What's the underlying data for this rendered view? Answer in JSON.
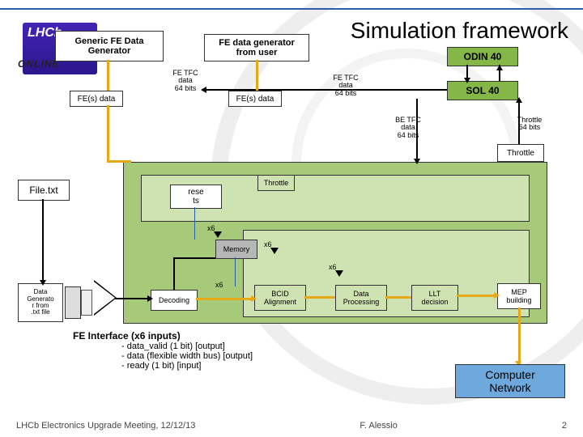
{
  "title": "Simulation framework",
  "logo": {
    "top": "LHCb",
    "bottom": "ONLINE"
  },
  "top_boxes": {
    "generic_generator_l1": "Generic FE Data",
    "generic_generator_l2": "Generator",
    "user_generator_l1": "FE data generator",
    "user_generator_l2": "from user",
    "odin": "ODIN 40",
    "sol": "SOL 40",
    "throttle": "Throttle"
  },
  "fe_data_boxes": {
    "left": "FE(s) data",
    "right": "FE(s) data"
  },
  "tfc_labels": {
    "fe_tfc_1": "FE TFC\ndata\n64 bits",
    "fe_tfc_2": "FE TFC\ndata\n64 bits",
    "be_tfc": "BE TFC\ndata\n64 bits",
    "throttle64": "Throttle\n64 bits"
  },
  "dsp": {
    "resets_l1": "rese",
    "resets_l2": "ts",
    "throttle": "Throttle",
    "memory": "Memory",
    "decoding": "Decoding",
    "bcid_l1": "BCID",
    "bcid_l2": "Alignment",
    "dproc_l1": "Data",
    "dproc_l2": "Processing",
    "llt_l1": "LLT",
    "llt_l2": "decision",
    "mep_l1": "MEP",
    "mep_l2": "building",
    "x6": "x6"
  },
  "left_blocks": {
    "file": "File.txt",
    "datagen_l1": "Data",
    "datagen_l2": "Generato",
    "datagen_l3": "r from",
    "datagen_l4": ".txt file"
  },
  "fe_interface": {
    "heading": "FE Interface (x6 inputs)",
    "line1": "- data_valid (1 bit) [output]",
    "line2": "- data (flexible width bus) [output]",
    "line3": "- ready (1 bit) [input]"
  },
  "network_l1": "Computer",
  "network_l2": "Network",
  "footer_left": "LHCb Electronics Upgrade Meeting, 12/12/13",
  "footer_center": "F. Alessio",
  "footer_right": "2"
}
